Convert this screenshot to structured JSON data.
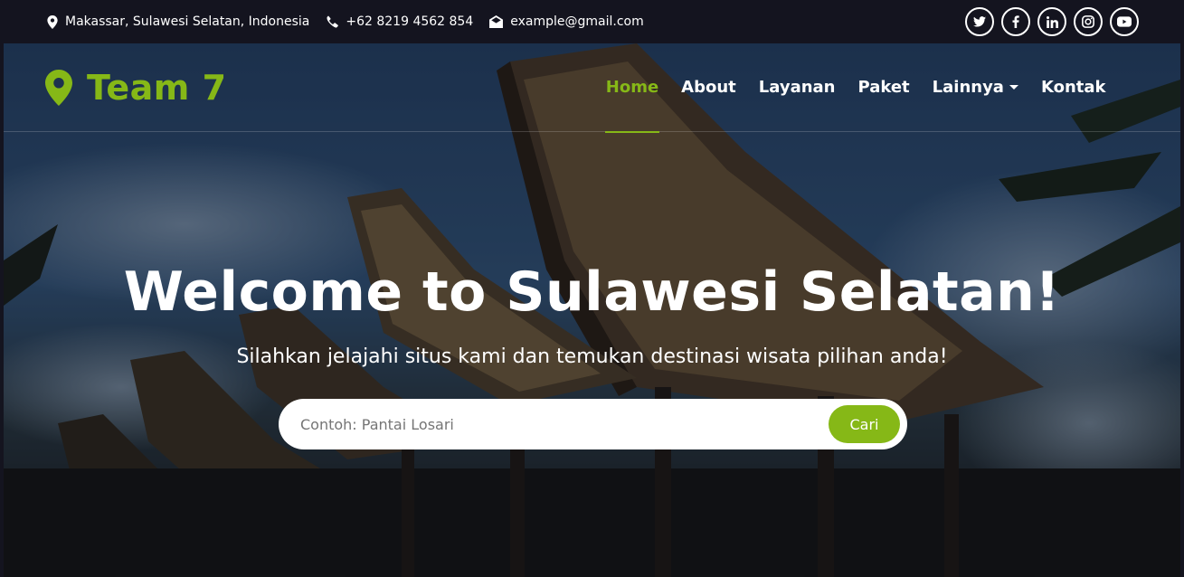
{
  "topbar": {
    "address": "Makassar, Sulawesi Selatan, Indonesia",
    "phone": "+62 8219 4562 854",
    "email": "example@gmail.com",
    "socials": [
      "twitter",
      "facebook",
      "linkedin",
      "instagram",
      "youtube"
    ]
  },
  "brand": {
    "name": "Team 7",
    "icon": "map-marker-icon",
    "color": "#86b817"
  },
  "nav": {
    "items": [
      {
        "label": "Home",
        "active": true
      },
      {
        "label": "About"
      },
      {
        "label": "Layanan"
      },
      {
        "label": "Paket"
      },
      {
        "label": "Lainnya",
        "dropdown": true
      },
      {
        "label": "Kontak"
      }
    ]
  },
  "hero": {
    "title": "Welcome to Sulawesi Selatan!",
    "subtitle": "Silahkan jelajahi situs kami dan temukan destinasi wisata pilihan anda!"
  },
  "search": {
    "placeholder": "Contoh: Pantai Losari",
    "value": "",
    "button_label": "Cari"
  },
  "colors": {
    "accent": "#86b817",
    "topbar_bg": "#14141f"
  }
}
